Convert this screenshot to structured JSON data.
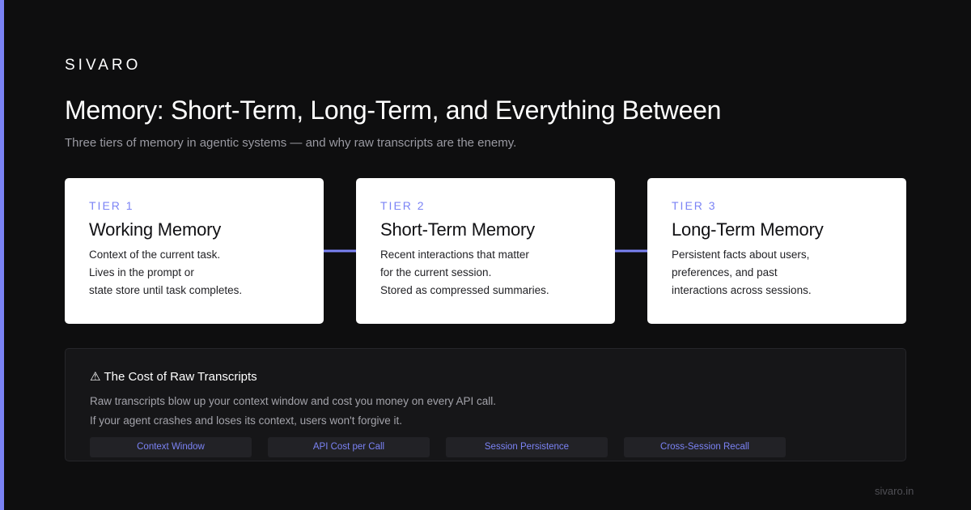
{
  "brand": "SIVARO",
  "title": "Memory: Short-Term, Long-Term, and Everything Between",
  "subtitle": "Three tiers of memory in agentic systems — and why raw transcripts are the enemy.",
  "tiers": [
    {
      "label": "TIER 1",
      "title": "Working Memory",
      "lines": [
        "Context of the current task.",
        "Lives in the prompt or",
        "state store until task completes."
      ]
    },
    {
      "label": "TIER 2",
      "title": "Short-Term Memory",
      "lines": [
        "Recent interactions that matter",
        "for the current session.",
        "Stored as compressed summaries."
      ]
    },
    {
      "label": "TIER 3",
      "title": "Long-Term Memory",
      "lines": [
        "Persistent facts about users,",
        "preferences, and past",
        "interactions across sessions."
      ]
    }
  ],
  "cost": {
    "icon": "⚠",
    "title": "The Cost of Raw Transcripts",
    "lines": [
      "Raw transcripts blow up your context window and cost you money on every API call.",
      "If your agent crashes and loses its context, users won't forgive it."
    ],
    "chips": [
      "Context Window",
      "API Cost per Call",
      "Session Persistence",
      "Cross-Session Recall"
    ]
  },
  "footer": "sivaro.in",
  "colors": {
    "background": "#0e0e0f",
    "accent": "#7b83f5",
    "card": "#ffffff",
    "panel": "#161618"
  }
}
